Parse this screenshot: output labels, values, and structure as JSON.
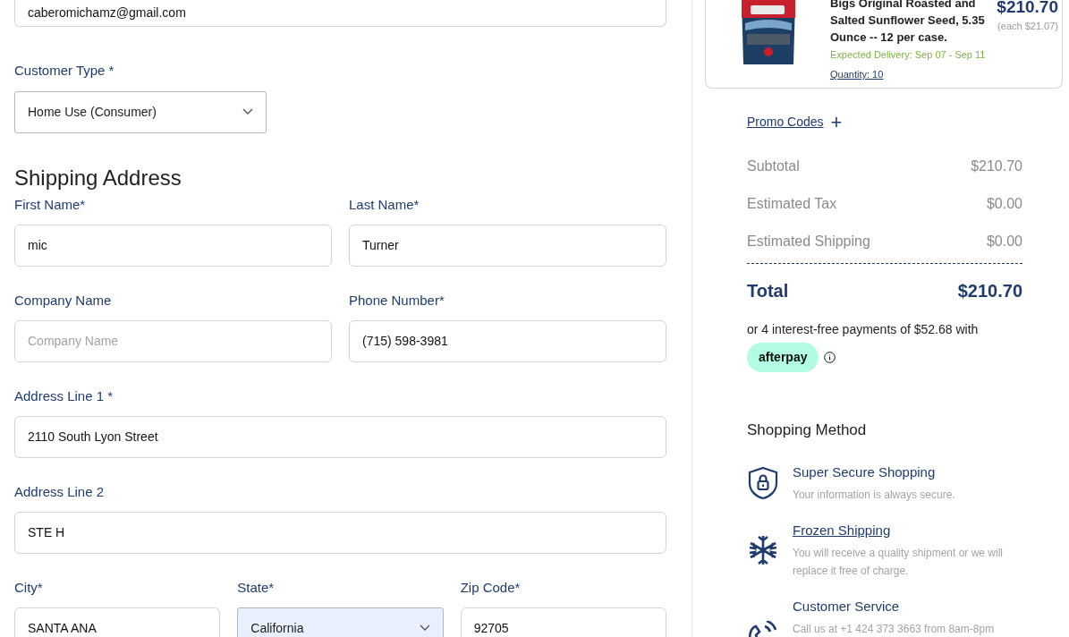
{
  "contact": {
    "email": {
      "value": "caberomichamz@gmail.com"
    }
  },
  "customer_type": {
    "label": "Customer Type *",
    "value": "Home Use (Consumer)"
  },
  "shipping_address": {
    "heading": "Shipping Address",
    "rows": [
      [
        {
          "label": "First Name*",
          "kind": "text",
          "value": "mic",
          "autofilled": false
        },
        {
          "label": "Last Name*",
          "kind": "text",
          "value": "Turner",
          "autofilled": false
        }
      ],
      [
        {
          "label": "Company Name",
          "kind": "text",
          "placeholder": "Company Name",
          "autofilled": false
        },
        {
          "label": "Phone Number*",
          "kind": "text",
          "value": "(715) 598-3981",
          "autofilled": false
        }
      ],
      [
        {
          "label": "Address Line 1 *",
          "kind": "text",
          "value": "2110 South Lyon Street",
          "autofilled": false
        }
      ],
      [
        {
          "label": "Address Line 2",
          "kind": "text",
          "value": "STE H",
          "autofilled": false
        }
      ],
      [
        {
          "label": "City*",
          "kind": "text",
          "value": "SANTA ANA",
          "autofilled": false
        },
        {
          "label": "State*",
          "kind": "select",
          "value": "California",
          "autofilled": true
        },
        {
          "label": "Zip Code*",
          "kind": "text",
          "value": "92705",
          "autofilled": false
        }
      ]
    ]
  },
  "cart_item": {
    "title_lines": [
      "Bigs Original Roasted and",
      "Salted Sunflower Seed, 5.35",
      "Ounce -- 12 per case."
    ],
    "price": "$210.70",
    "unit_price": "(each $21.07)",
    "delivery": "Expected Delivery: Sep 07 - Sep 11",
    "quantity": "Quantity: 10"
  },
  "promo": {
    "label": "Promo Codes",
    "icon": "+"
  },
  "summary": [
    {
      "label": "Subtotal",
      "value": "$210.70"
    },
    {
      "label": "Estimated Tax",
      "value": "$0.00"
    },
    {
      "label": "Estimated Shipping",
      "value": "$0.00"
    }
  ],
  "total": {
    "label": "Total",
    "value": "$210.70"
  },
  "afterpay": {
    "text": "or 4 interest-free payments of $52.68 with",
    "badge": "afterpay"
  },
  "shopping_method": {
    "heading": "Shopping Method",
    "items": [
      {
        "kind": "secure",
        "title": "Super Secure Shopping",
        "link": false,
        "description": "Your information is always secure."
      },
      {
        "kind": "frozen",
        "title": "Frozen Shipping",
        "link": true,
        "description": "You will receive a quality shipment or we will replace it free of charge."
      },
      {
        "kind": "service",
        "title": "Customer Service",
        "link": false,
        "description": "Call us at +1 424 373 3663 from 8am-8pm"
      }
    ]
  }
}
